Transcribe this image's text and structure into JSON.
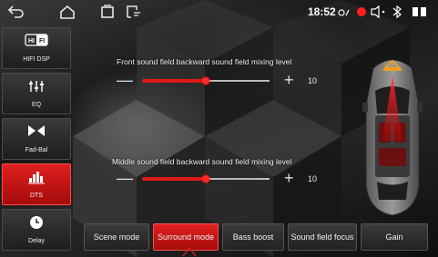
{
  "status_bar": {
    "time": "18:52",
    "icons": [
      "back-arrow-icon",
      "home-icon",
      "recent-apps-icon",
      "cast-icon",
      "signal-icon",
      "record-dot-icon",
      "volume-icon",
      "bluetooth-icon",
      "battery-icon"
    ]
  },
  "sidebar": {
    "items": [
      {
        "label": "HIFI DSP",
        "icon": "hifi-icon",
        "active": false
      },
      {
        "label": "EQ",
        "icon": "eq-sliders-icon",
        "active": false
      },
      {
        "label": "Fad-Bal",
        "icon": "fader-balance-icon",
        "active": false
      },
      {
        "label": "DTS",
        "icon": "dts-bars-icon",
        "active": true
      },
      {
        "label": "Delay",
        "icon": "clock-icon",
        "active": false
      }
    ]
  },
  "sliders": [
    {
      "label": "Front sound field backward sound field mixing level",
      "value": "10",
      "level_fraction": 0.5
    },
    {
      "label": "Middle sound field backward sound field mixing level",
      "value": "10",
      "level_fraction": 0.5
    }
  ],
  "tabs": [
    {
      "label": "Scene mode",
      "active": false
    },
    {
      "label": "Surround mode",
      "active": true
    },
    {
      "label": "Bass boost",
      "active": false
    },
    {
      "label": "Sound field focus",
      "active": false
    },
    {
      "label": "Gain",
      "active": false
    }
  ],
  "colors": {
    "accent": "#e01818",
    "sound_field_marker": "#f0a020"
  }
}
